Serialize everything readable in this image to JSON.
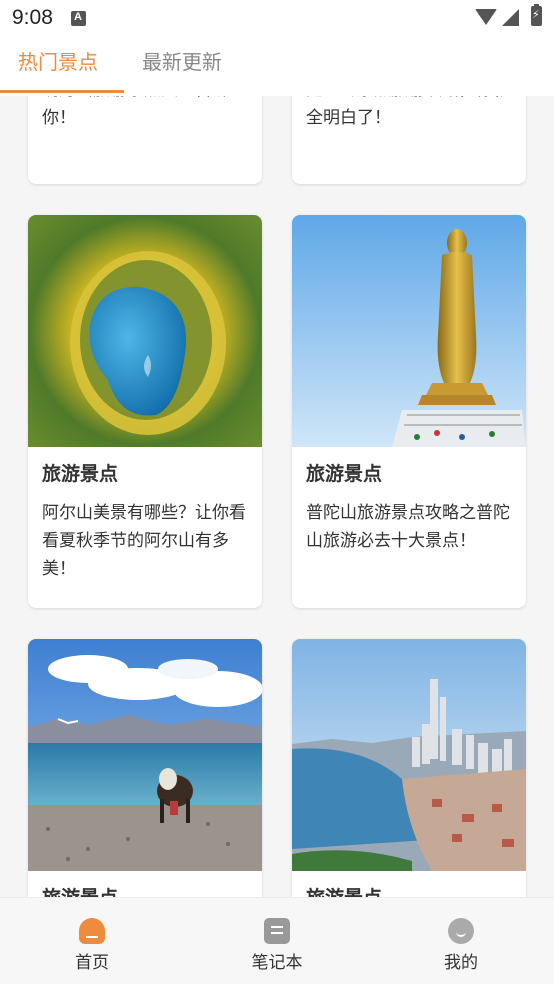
{
  "status_bar": {
    "time": "9:08"
  },
  "tabs": [
    {
      "label": "热门景点",
      "active": true
    },
    {
      "label": "最新更新",
      "active": false
    }
  ],
  "colors": {
    "accent": "#f08a3c",
    "inactive_tab": "#888888",
    "nav_bg": "#f7f7f7"
  },
  "cards_partial_top": [
    {
      "desc": "明月山旅游景点大全告诉你！"
    },
    {
      "desc": "完篁岭景点旅游攻略，你就全明白了！"
    }
  ],
  "cards": [
    {
      "title": "旅游景点",
      "desc": "阿尔山美景有哪些？让你看看夏秋季节的阿尔山有多美！",
      "image": "forest-lake-photo"
    },
    {
      "title": "旅游景点",
      "desc": "普陀山旅游景点攻略之普陀山旅游必去十大景点！",
      "image": "golden-buddha-statue-photo"
    },
    {
      "title": "旅游景点",
      "image": "yak-lakeside-photo"
    },
    {
      "title": "旅游景点",
      "image": "coastal-city-photo"
    }
  ],
  "bottom_nav": [
    {
      "label": "首页",
      "icon": "home-icon",
      "active": true
    },
    {
      "label": "笔记本",
      "icon": "notebook-icon",
      "active": false
    },
    {
      "label": "我的",
      "icon": "profile-icon",
      "active": false
    }
  ]
}
